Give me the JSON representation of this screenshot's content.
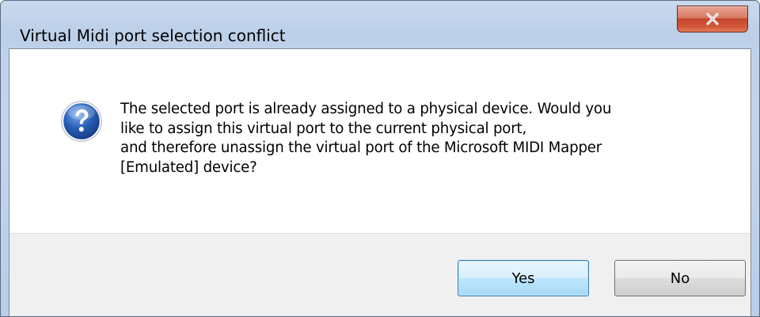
{
  "window": {
    "title": "Virtual Midi port selection conflict"
  },
  "icons": {
    "close": "close-icon",
    "message": "question-icon"
  },
  "message": {
    "lines": [
      "The selected port is already assigned to a physical device. Would you",
      "like to assign this virtual port to the current physical port,",
      "and therefore unassign the virtual port of the Microsoft MIDI Mapper",
      "[Emulated] device?"
    ]
  },
  "buttons": {
    "yes_label": "Yes",
    "no_label": "No"
  },
  "colors": {
    "default_button_border": "#3c7fb1",
    "close_button": "#c4452b",
    "question_icon": "#2a5fb8"
  }
}
